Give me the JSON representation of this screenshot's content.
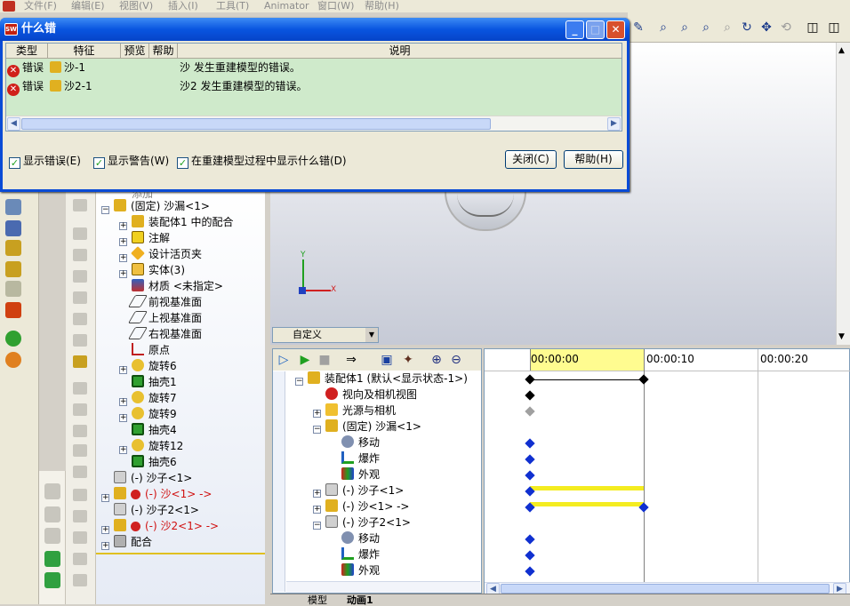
{
  "menu": {
    "items": [
      "文件(F)",
      "编辑(E)",
      "视图(V)",
      "插入(I)",
      "工具(T)",
      "Animator",
      "窗口(W)",
      "帮助(H)"
    ]
  },
  "dialog": {
    "title": "什么错",
    "columns": [
      "类型",
      "特征",
      "预览",
      "帮助",
      "说明"
    ],
    "rows": [
      {
        "type": "错误",
        "feature": "沙-1",
        "description": "沙 发生重建模型的错误。"
      },
      {
        "type": "错误",
        "feature": "沙2-1",
        "description": "沙2 发生重建模型的错误。"
      }
    ],
    "show_errors_label": "显示错误(E)",
    "show_warnings_label": "显示警告(W)",
    "show_during_rebuild_label": "在重建模型过程中显示什么错(D)",
    "close_label": "关闭(C)",
    "help_label": "帮助(H)"
  },
  "feature_tree": {
    "items": [
      {
        "label": "添加"
      },
      {
        "label": "(固定) 沙漏<1>"
      },
      {
        "label": "装配体1 中的配合"
      },
      {
        "label": "注解"
      },
      {
        "label": "设计活页夹"
      },
      {
        "label": "实体(3)"
      },
      {
        "label": "材质 <未指定>"
      },
      {
        "label": "前视基准面"
      },
      {
        "label": "上视基准面"
      },
      {
        "label": "右视基准面"
      },
      {
        "label": "原点"
      },
      {
        "label": "旋转6"
      },
      {
        "label": "抽壳1"
      },
      {
        "label": "旋转7"
      },
      {
        "label": "旋转9"
      },
      {
        "label": "抽壳4"
      },
      {
        "label": "旋转12"
      },
      {
        "label": "抽壳6"
      },
      {
        "label": "(-) 沙子<1>"
      },
      {
        "label": "(-) 沙<1> ->"
      },
      {
        "label": "(-) 沙子2<1>"
      },
      {
        "label": "(-) 沙2<1> ->"
      },
      {
        "label": "配合"
      }
    ]
  },
  "viewport": {
    "config_combo": "自定义",
    "axis_x": "X",
    "axis_y": "Y"
  },
  "animator": {
    "tree": [
      {
        "label": "装配体1 (默认<显示状态-1>)"
      },
      {
        "label": "视向及相机视图"
      },
      {
        "label": "光源与相机"
      },
      {
        "label": "(固定) 沙漏<1>"
      },
      {
        "label": "移动"
      },
      {
        "label": "爆炸"
      },
      {
        "label": "外观"
      },
      {
        "label": "(-) 沙子<1>"
      },
      {
        "label": "(-) 沙<1> ->"
      },
      {
        "label": "(-) 沙子2<1>"
      },
      {
        "label": "移动"
      },
      {
        "label": "爆炸"
      },
      {
        "label": "外观"
      }
    ],
    "time_labels": [
      "00:00:00",
      "00:00:10",
      "00:00:20"
    ],
    "tabs": [
      "模型",
      "动画1"
    ]
  },
  "colors": {
    "title_bar": "#0955e0",
    "list_bg": "#cfeacb",
    "timeline_highlight": "#f4ec20",
    "key_blue": "#1030d0",
    "error_text": "#d01010"
  }
}
